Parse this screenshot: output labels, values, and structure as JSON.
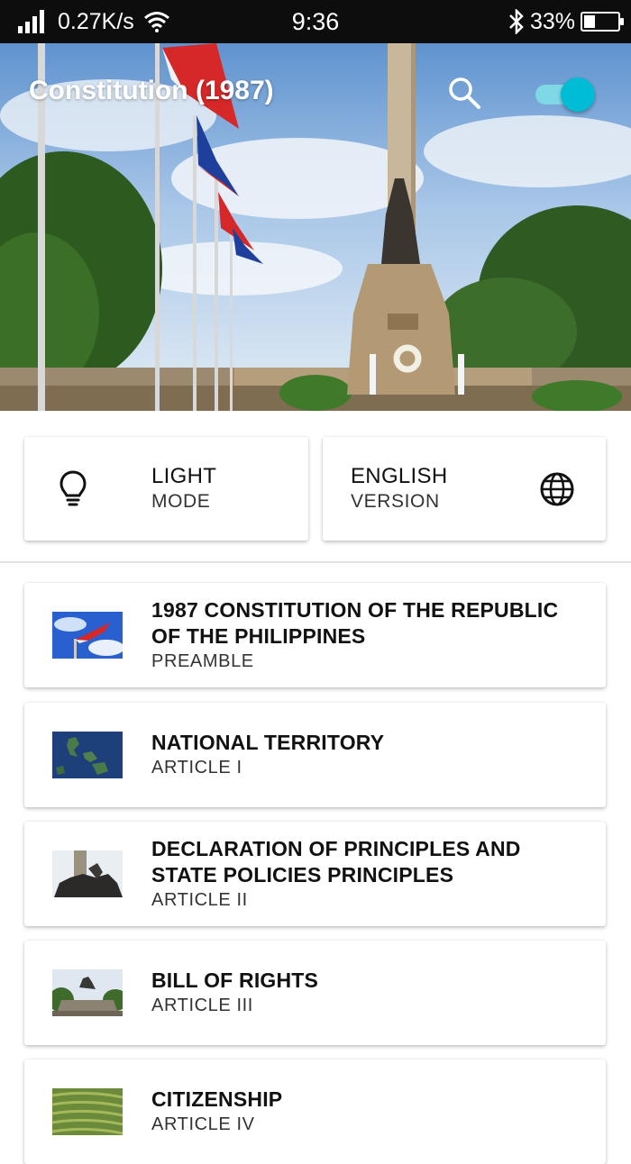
{
  "status_bar": {
    "speed": "0.27K/s",
    "time": "9:36",
    "battery": "33%",
    "battery_level": 0.33
  },
  "app": {
    "title": "Constitution (1987)",
    "search_icon": "search-icon",
    "theme_toggle_on": true
  },
  "options": [
    {
      "title": "LIGHT",
      "subtitle": "MODE",
      "icon": "lightbulb-icon"
    },
    {
      "title": "ENGLISH",
      "subtitle": "VERSION",
      "icon": "globe-icon"
    }
  ],
  "articles": [
    {
      "title": "1987 CONSTITUTION OF THE REPUBLIC OF THE PHILIPPINES",
      "subtitle": "PREAMBLE",
      "thumb": "flag-thumbnail"
    },
    {
      "title": "NATIONAL TERRITORY",
      "subtitle": "ARTICLE I",
      "thumb": "map-thumbnail"
    },
    {
      "title": "DECLARATION OF PRINCIPLES AND STATE POLICIES PRINCIPLES",
      "subtitle": "ARTICLE II",
      "thumb": "monument-thumbnail"
    },
    {
      "title": "BILL OF RIGHTS",
      "subtitle": "ARTICLE III",
      "thumb": "monument-park-thumbnail"
    },
    {
      "title": "CITIZENSHIP",
      "subtitle": "ARTICLE IV",
      "thumb": "rice-terraces-thumbnail"
    }
  ],
  "colors": {
    "accent": "#00bcd4",
    "status_bar": "#0d0d0d"
  }
}
